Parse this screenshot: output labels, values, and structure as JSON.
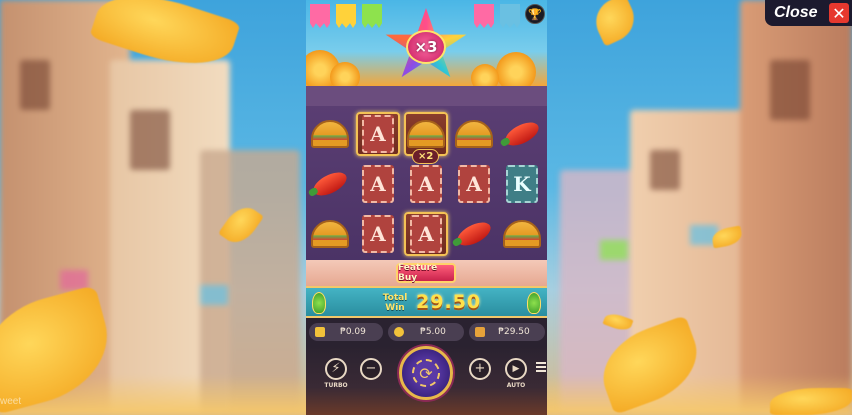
{
  "banner": {
    "multiplier": "×3",
    "trophy_icon": "trophy-icon"
  },
  "grid": {
    "symbol_multiplier": "×2",
    "colors": {
      "card_a": "#b0433e",
      "card_k": "#3f7e86",
      "gold_frame": "#f4c255",
      "grid_bg": "#4b3366"
    },
    "rows": [
      [
        "taco",
        "card-a-gold",
        "taco-gold",
        "taco",
        "chili"
      ],
      [
        "chili",
        "card-a",
        "card-a",
        "card-a",
        "card-k"
      ],
      [
        "taco",
        "card-a",
        "card-a-gold",
        "chili",
        "taco"
      ]
    ],
    "card_labels": {
      "a": "A",
      "k": "K"
    }
  },
  "feature_buy": {
    "label": "Feature Buy"
  },
  "win": {
    "label": "Total Win",
    "value": "29.50"
  },
  "info": {
    "balance": "₱0.09",
    "bet": "₱5.00",
    "last_win": "₱29.50"
  },
  "controls": {
    "turbo_label": "TURBO",
    "minus": "−",
    "plus": "+",
    "auto_label": "AUTO",
    "spin_icon": "spin-arrows-icon"
  },
  "close": {
    "label": "Close",
    "x": "✕"
  },
  "edge_text": "weet",
  "accent": "#f2c86a"
}
